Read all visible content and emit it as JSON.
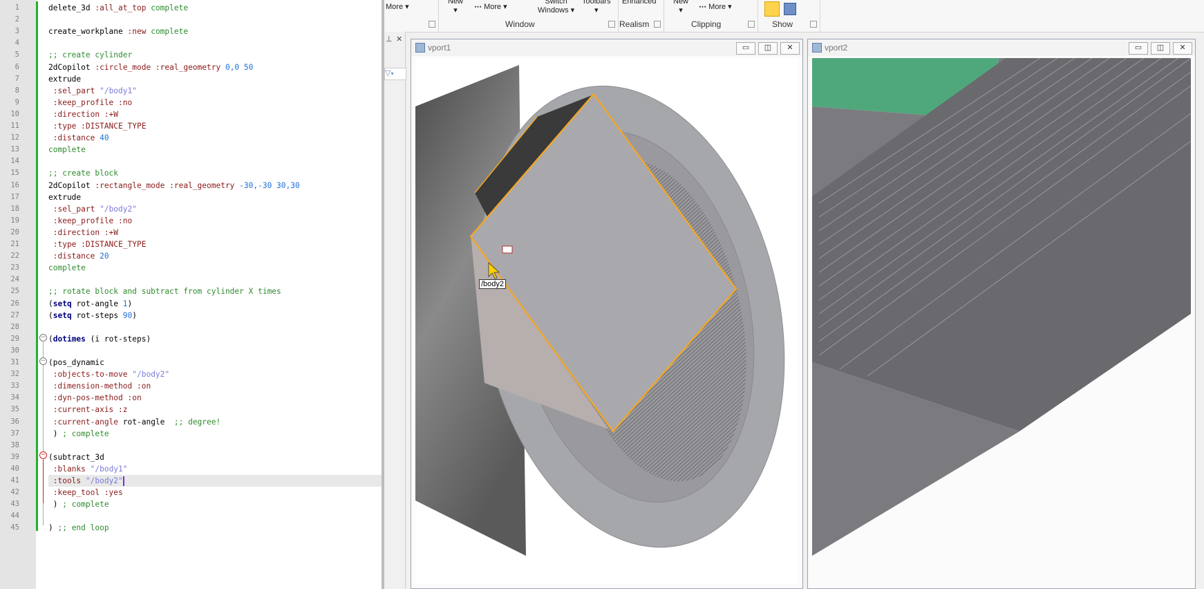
{
  "editor": {
    "lines": [
      {
        "n": "1",
        "tokens": [
          [
            "kw",
            "delete_3d "
          ],
          [
            "key",
            ":all_at_top "
          ],
          [
            "cmt",
            "complete"
          ]
        ]
      },
      {
        "n": "2",
        "tokens": []
      },
      {
        "n": "3",
        "tokens": [
          [
            "kw",
            "create_workplane "
          ],
          [
            "key",
            ":new "
          ],
          [
            "cmt",
            "complete"
          ]
        ]
      },
      {
        "n": "4",
        "tokens": []
      },
      {
        "n": "5",
        "tokens": [
          [
            "cmt",
            ";; create cylinder"
          ]
        ]
      },
      {
        "n": "6",
        "tokens": [
          [
            "kw",
            "2dCopilot "
          ],
          [
            "key",
            ":circle_mode :real_geometry "
          ],
          [
            "num",
            "0,0 50"
          ]
        ]
      },
      {
        "n": "7",
        "tokens": [
          [
            "kw",
            "extrude"
          ]
        ]
      },
      {
        "n": "8",
        "tokens": [
          [
            "key",
            " :sel_part "
          ],
          [
            "str",
            "\"/body1\""
          ]
        ]
      },
      {
        "n": "9",
        "tokens": [
          [
            "key",
            " :keep_profile :no"
          ]
        ]
      },
      {
        "n": "10",
        "tokens": [
          [
            "key",
            " :direction :+W"
          ]
        ]
      },
      {
        "n": "11",
        "tokens": [
          [
            "key",
            " :type :DISTANCE_TYPE"
          ]
        ]
      },
      {
        "n": "12",
        "tokens": [
          [
            "key",
            " :distance "
          ],
          [
            "num",
            "40"
          ]
        ]
      },
      {
        "n": "13",
        "tokens": [
          [
            "cmt",
            "complete"
          ]
        ]
      },
      {
        "n": "14",
        "tokens": []
      },
      {
        "n": "15",
        "tokens": [
          [
            "cmt",
            ";; create block"
          ]
        ]
      },
      {
        "n": "16",
        "tokens": [
          [
            "kw",
            "2dCopilot "
          ],
          [
            "key",
            ":rectangle_mode :real_geometry "
          ],
          [
            "num",
            "-30,-30 30,30"
          ]
        ]
      },
      {
        "n": "17",
        "tokens": [
          [
            "kw",
            "extrude"
          ]
        ]
      },
      {
        "n": "18",
        "tokens": [
          [
            "key",
            " :sel_part "
          ],
          [
            "str",
            "\"/body2\""
          ]
        ]
      },
      {
        "n": "19",
        "tokens": [
          [
            "key",
            " :keep_profile :no"
          ]
        ]
      },
      {
        "n": "20",
        "tokens": [
          [
            "key",
            " :direction :+W"
          ]
        ]
      },
      {
        "n": "21",
        "tokens": [
          [
            "key",
            " :type :DISTANCE_TYPE"
          ]
        ]
      },
      {
        "n": "22",
        "tokens": [
          [
            "key",
            " :distance "
          ],
          [
            "num",
            "20"
          ]
        ]
      },
      {
        "n": "23",
        "tokens": [
          [
            "cmt",
            "complete"
          ]
        ]
      },
      {
        "n": "24",
        "tokens": []
      },
      {
        "n": "25",
        "tokens": [
          [
            "cmt",
            ";; rotate block and subtract from cylinder X times"
          ]
        ]
      },
      {
        "n": "26",
        "tokens": [
          [
            "plain",
            "("
          ],
          [
            "bold",
            "setq"
          ],
          [
            "plain",
            " rot-angle "
          ],
          [
            "num",
            "1"
          ],
          [
            "plain",
            ")"
          ]
        ]
      },
      {
        "n": "27",
        "tokens": [
          [
            "plain",
            "("
          ],
          [
            "bold",
            "setq"
          ],
          [
            "plain",
            " rot-steps "
          ],
          [
            "num",
            "90"
          ],
          [
            "plain",
            ")"
          ]
        ]
      },
      {
        "n": "28",
        "tokens": []
      },
      {
        "n": "29",
        "tokens": [
          [
            "plain",
            "("
          ],
          [
            "bold",
            "dotimes"
          ],
          [
            "plain",
            " (i rot-steps)"
          ]
        ]
      },
      {
        "n": "30",
        "tokens": []
      },
      {
        "n": "31",
        "tokens": [
          [
            "plain",
            "(pos_dynamic"
          ]
        ]
      },
      {
        "n": "32",
        "tokens": [
          [
            "key",
            " :objects-to-move "
          ],
          [
            "str",
            "\"/body2\""
          ]
        ]
      },
      {
        "n": "33",
        "tokens": [
          [
            "key",
            " :dimension-method :on"
          ]
        ]
      },
      {
        "n": "34",
        "tokens": [
          [
            "key",
            " :dyn-pos-method :on"
          ]
        ]
      },
      {
        "n": "35",
        "tokens": [
          [
            "key",
            " :current-axis :z"
          ]
        ]
      },
      {
        "n": "36",
        "tokens": [
          [
            "key",
            " :current-angle "
          ],
          [
            "plain",
            "rot-angle  "
          ],
          [
            "cmt",
            ";; degree!"
          ]
        ]
      },
      {
        "n": "37",
        "tokens": [
          [
            "plain",
            " ) "
          ],
          [
            "cmt",
            "; complete"
          ]
        ]
      },
      {
        "n": "38",
        "tokens": []
      },
      {
        "n": "39",
        "tokens": [
          [
            "plain",
            "(subtract_3d"
          ]
        ]
      },
      {
        "n": "40",
        "tokens": [
          [
            "key",
            " :blanks "
          ],
          [
            "str",
            "\"/body1\""
          ]
        ]
      },
      {
        "n": "41",
        "tokens": [
          [
            "key",
            " :tools "
          ],
          [
            "str",
            "\"/body2\""
          ]
        ],
        "current": true
      },
      {
        "n": "42",
        "tokens": [
          [
            "key",
            " :keep_tool :yes"
          ]
        ]
      },
      {
        "n": "43",
        "tokens": [
          [
            "plain",
            " ) "
          ],
          [
            "cmt",
            "; complete"
          ]
        ]
      },
      {
        "n": "44",
        "tokens": []
      },
      {
        "n": "45",
        "tokens": [
          [
            "plain",
            ") "
          ],
          [
            "cmt",
            ";; end loop"
          ]
        ]
      }
    ]
  },
  "ribbon": {
    "more1": "More",
    "new1": "New",
    "more2": "More",
    "switch_windows_1": "Switch",
    "switch_windows_2": "Windows",
    "toolbars": "Toolbars",
    "enhanced": "Enhanced",
    "new2": "New",
    "more3": "More",
    "groups": {
      "window": "Window",
      "realism": "Realism",
      "clipping": "Clipping",
      "show": "Show"
    }
  },
  "viewports": {
    "left": {
      "title": "vport1",
      "tooltip": "/body2"
    },
    "right": {
      "title": "vport2"
    }
  },
  "colors": {
    "selection_edge": "#f5a623",
    "solid_face": "#a9a9ad",
    "green_face": "#4fa87c"
  }
}
